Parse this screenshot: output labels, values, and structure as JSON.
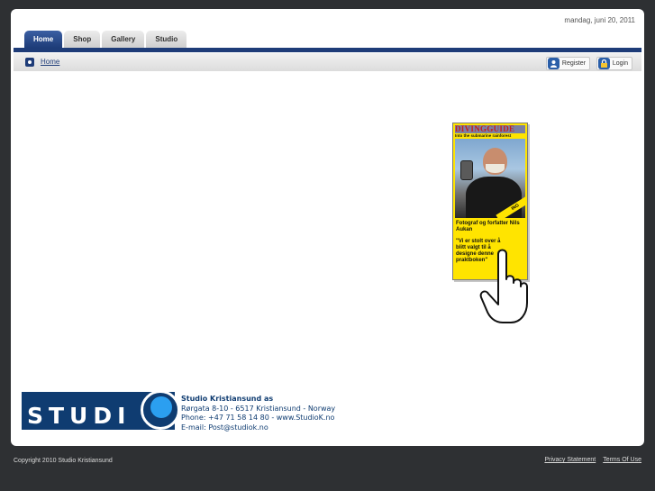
{
  "header": {
    "date": "mandag, juni 20, 2011",
    "tabs": [
      {
        "label": "Home",
        "active": true
      },
      {
        "label": "Shop",
        "active": false
      },
      {
        "label": "Gallery",
        "active": false
      },
      {
        "label": "Studio",
        "active": false
      }
    ]
  },
  "breadcrumb": {
    "home_label": "Home"
  },
  "toolbar": {
    "register_label": "Register",
    "login_label": "Login"
  },
  "ad": {
    "masthead_a": "DIVING",
    "masthead_b": "GUIDE",
    "subtitle": "Into the submarine rainforest",
    "stripe": "ING",
    "caption_1": "Fotograf og forfatter Nils Aukan",
    "caption_2": "\"Vi er stolt over å blitt valgt til å designe denne praktboken\""
  },
  "footer_block": {
    "logo_text": "STUDI",
    "company": "Studio Kristiansund as",
    "address": "Rørgata 8-10 - 6517 Kristiansund - Norway",
    "phone": "Phone: +47 71 58 14 80 - www.StudioK.no",
    "email": "E-mail: Post@studiok.no"
  },
  "footer": {
    "copyright": "Copyright 2010 Studio Kristiansund",
    "privacy": "Privacy Statement",
    "terms": "Terms Of Use"
  },
  "colors": {
    "brand": "#1e3c78",
    "accent": "#2b9ff0",
    "ad_yellow": "#ffe400"
  }
}
